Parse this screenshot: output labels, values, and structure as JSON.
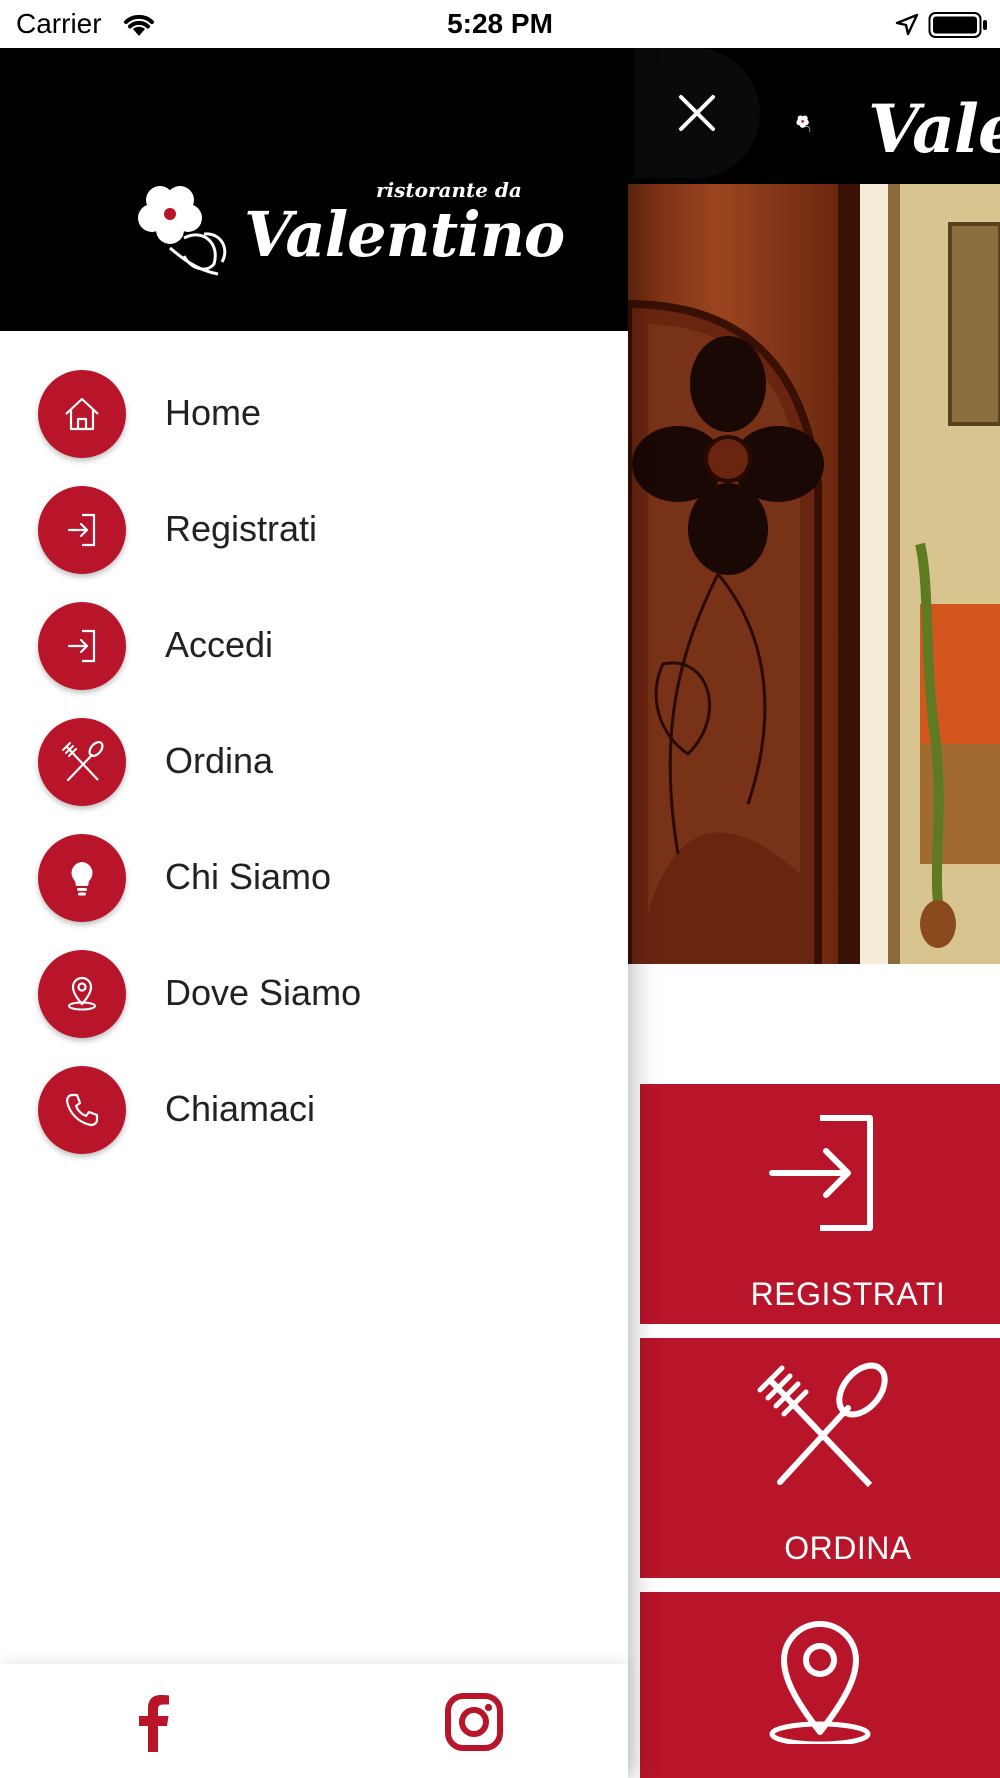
{
  "status_bar": {
    "carrier": "Carrier",
    "time": "5:28 PM"
  },
  "brand": {
    "tagline": "ristorante da",
    "name": "Valentino",
    "header_name_partial": "Vale",
    "accent_color": "#b8142a"
  },
  "drawer": {
    "menu": [
      {
        "label": "Home",
        "icon": "home-icon"
      },
      {
        "label": "Registrati",
        "icon": "login-icon"
      },
      {
        "label": "Accedi",
        "icon": "login-icon"
      },
      {
        "label": "Ordina",
        "icon": "utensils-icon"
      },
      {
        "label": "Chi Siamo",
        "icon": "lightbulb-icon"
      },
      {
        "label": "Dove Siamo",
        "icon": "map-pin-icon"
      },
      {
        "label": "Chiamaci",
        "icon": "phone-icon"
      }
    ],
    "footer": {
      "facebook_icon": "facebook-icon",
      "instagram_icon": "instagram-icon"
    }
  },
  "main": {
    "close_icon": "close-icon",
    "tiles": [
      {
        "label": "REGISTRATI",
        "icon": "login-icon"
      },
      {
        "label": "ORDINA",
        "icon": "utensils-icon"
      },
      {
        "label": "",
        "icon": "map-pin-icon"
      }
    ]
  }
}
